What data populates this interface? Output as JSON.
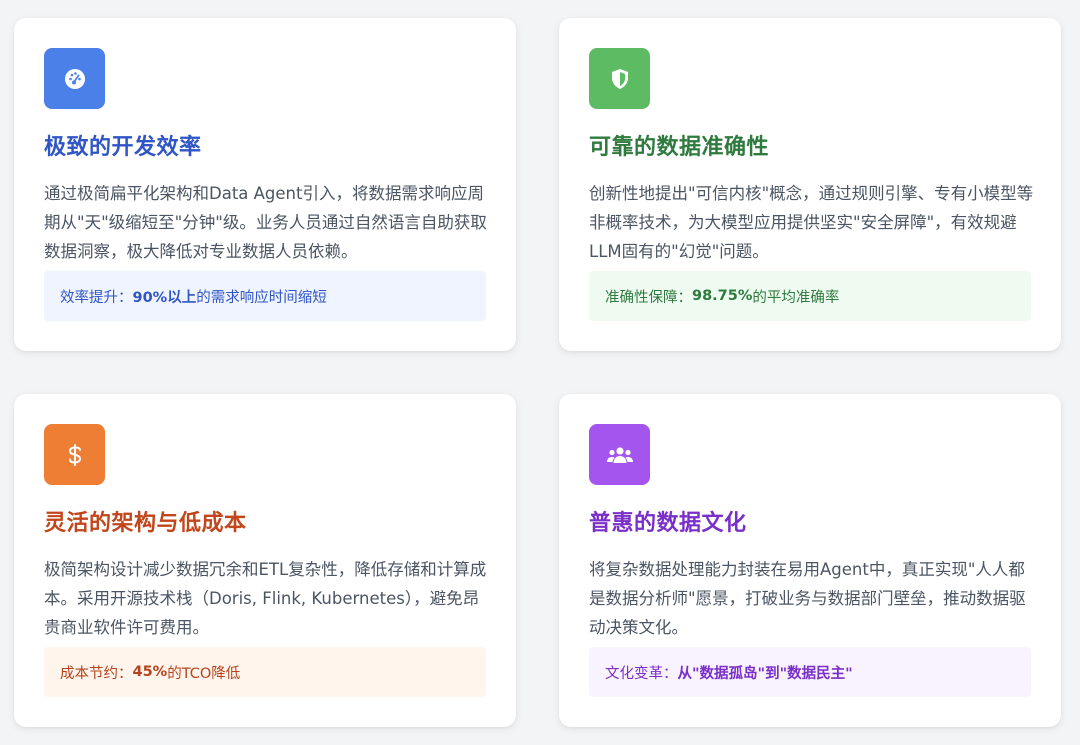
{
  "cards": [
    {
      "theme": "blue",
      "icon": "speedometer-icon",
      "title": "极致的开发效率",
      "description": "通过极简扁平化架构和Data Agent引入，将数据需求响应周期从\"天\"级缩短至\"分钟\"级。业务人员通过自然语言自助获取数据洞察，极大降低对专业数据人员依赖。",
      "highlight_label": "效率提升：",
      "highlight_strong": "90%以上",
      "highlight_rest": "的需求响应时间缩短"
    },
    {
      "theme": "green",
      "icon": "shield-icon",
      "title": "可靠的数据准确性",
      "description": "创新性地提出\"可信内核\"概念，通过规则引擎、专有小模型等非概率技术，为大模型应用提供坚实\"安全屏障\"，有效规避LLM固有的\"幻觉\"问题。",
      "highlight_label": "准确性保障：",
      "highlight_strong": "98.75%",
      "highlight_rest": "的平均准确率"
    },
    {
      "theme": "orange",
      "icon": "dollar-icon",
      "title": "灵活的架构与低成本",
      "description": "极简架构设计减少数据冗余和ETL复杂性，降低存储和计算成本。采用开源技术栈（Doris, Flink, Kubernetes），避免昂贵商业软件许可费用。",
      "highlight_label": "成本节约：",
      "highlight_strong": "45%",
      "highlight_rest": "的TCO降低"
    },
    {
      "theme": "purple",
      "icon": "users-icon",
      "title": "普惠的数据文化",
      "description": "将复杂数据处理能力封装在易用Agent中，真正实现\"人人都是数据分析师\"愿景，打破业务与数据部门壁垒，推动数据驱动决策文化。",
      "highlight_label": "文化变革：",
      "highlight_strong": "从\"数据孤岛\"到\"数据民主\"",
      "highlight_rest": ""
    }
  ],
  "colors": {
    "blue": "#4a80e8",
    "green": "#5cbb63",
    "orange": "#ee7e34",
    "purple": "#a455ee"
  }
}
